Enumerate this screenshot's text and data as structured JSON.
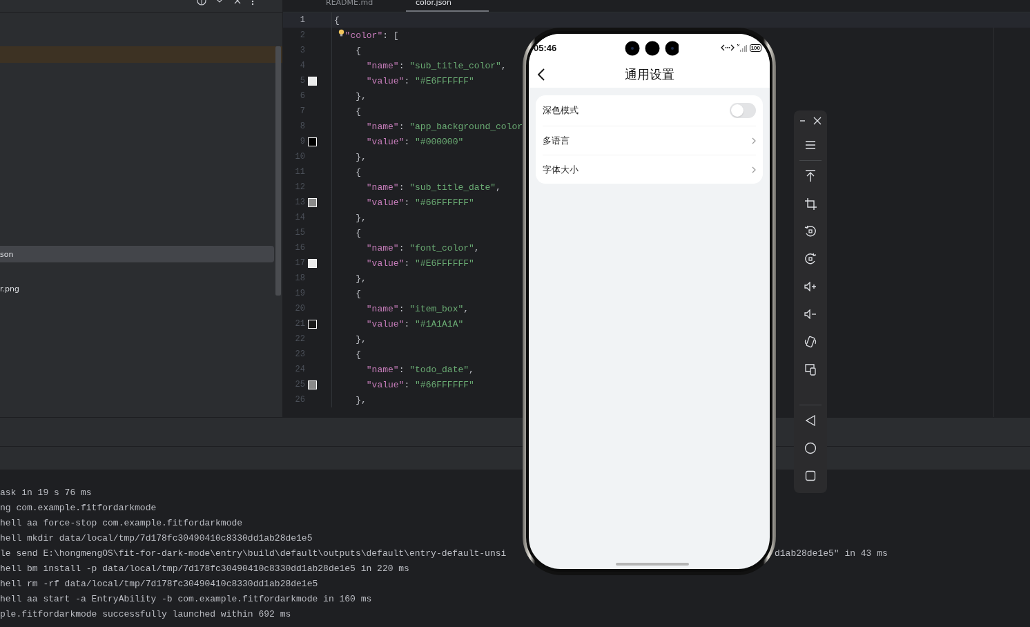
{
  "sidebar": {
    "rows": [
      {
        "kind": "highlight"
      },
      {
        "kind": "file",
        "label": "son",
        "selected": true
      },
      {
        "kind": "file",
        "label": "r.png",
        "selected": false
      }
    ]
  },
  "editor": {
    "tabs": [
      {
        "label": "README.md",
        "selected": false
      },
      {
        "label": "color.json",
        "selected": true
      }
    ],
    "lines": [
      {
        "number": "1",
        "code": "{",
        "current": true
      },
      {
        "number": "2",
        "code": "  \"color\": [",
        "bulb": true
      },
      {
        "number": "3",
        "code": "    {"
      },
      {
        "number": "4",
        "code": "      \"name\": \"sub_title_color\","
      },
      {
        "number": "5",
        "code": "      \"value\": \"#E6FFFFFF\"",
        "color": "#ebebeb"
      },
      {
        "number": "6",
        "code": "    },"
      },
      {
        "number": "7",
        "code": "    {"
      },
      {
        "number": "8",
        "code": "      \"name\": \"app_background_color"
      },
      {
        "number": "9",
        "code": "      \"value\": \"#000000\"",
        "color": "#000000"
      },
      {
        "number": "10",
        "code": "    },"
      },
      {
        "number": "11",
        "code": "    {"
      },
      {
        "number": "12",
        "code": "      \"name\": \"sub_title_date\","
      },
      {
        "number": "13",
        "code": "      \"value\": \"#66FFFFFF\"",
        "color": "#8a8a8a"
      },
      {
        "number": "14",
        "code": "    },"
      },
      {
        "number": "15",
        "code": "    {"
      },
      {
        "number": "16",
        "code": "      \"name\": \"font_color\","
      },
      {
        "number": "17",
        "code": "      \"value\": \"#E6FFFFFF\"",
        "color": "#ebebeb"
      },
      {
        "number": "18",
        "code": "    },"
      },
      {
        "number": "19",
        "code": "    {"
      },
      {
        "number": "20",
        "code": "      \"name\": \"item_box\","
      },
      {
        "number": "21",
        "code": "      \"value\": \"#1A1A1A\"",
        "color": "#1a1a1a"
      },
      {
        "number": "22",
        "code": "    },"
      },
      {
        "number": "23",
        "code": "    {"
      },
      {
        "number": "24",
        "code": "      \"name\": \"todo_date\","
      },
      {
        "number": "25",
        "code": "      \"value\": \"#66FFFFFF\"",
        "color": "#8a8a8a"
      },
      {
        "number": "26",
        "code": "    },"
      }
    ]
  },
  "console": {
    "lines": [
      {
        "text": "ask in 19 s 76 ms"
      },
      {
        "text": "ng com.example.fitfordarkmode"
      },
      {
        "text": "hell aa force-stop com.example.fitfordarkmode"
      },
      {
        "text": "hell mkdir data/local/tmp/7d178fc30490410c8330dd1ab28de1e5"
      },
      {
        "text": "le send E:\\hongmengOS\\fit-for-dark-mode\\entry\\build\\default\\outputs\\default\\entry-default-unsi",
        "text_after_overlay": "d1ab28de1e5\" in 43 ms"
      },
      {
        "text": "hell bm install -p data/local/tmp/7d178fc30490410c8330dd1ab28de1e5 in 220 ms"
      },
      {
        "text": "hell rm -rf data/local/tmp/7d178fc30490410c8330dd1ab28de1e5"
      },
      {
        "text": "hell aa start -a EntryAbility -b com.example.fitfordarkmode in 160 ms"
      },
      {
        "text": "ple.fitfordarkmode successfully launched within 692 ms"
      }
    ]
  },
  "phone": {
    "status_bar": {
      "time": "05:46",
      "battery": "100"
    },
    "title": "通用设置",
    "settings": [
      {
        "kind": "toggle",
        "label": "深色模式",
        "on": false
      },
      {
        "kind": "link",
        "label": "多语言"
      },
      {
        "kind": "link",
        "label": "字体大小"
      }
    ]
  }
}
